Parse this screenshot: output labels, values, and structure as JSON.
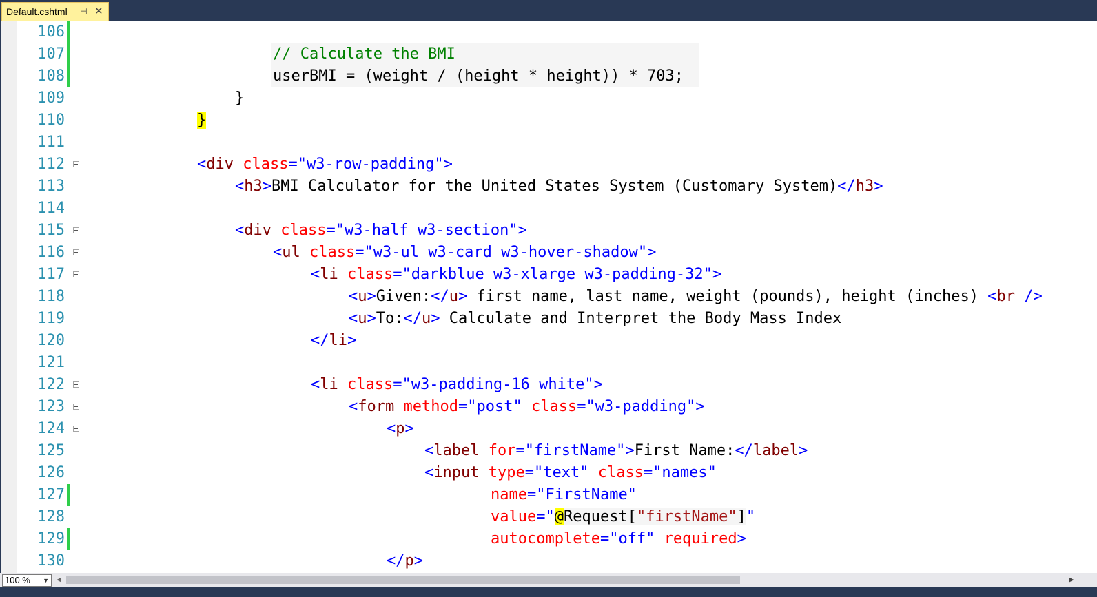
{
  "tab": {
    "label": "Default.cshtml",
    "pin_glyph": "⊣",
    "close_glyph": "✕"
  },
  "zoom": {
    "value": "100 %"
  },
  "lines": [
    {
      "num": "106",
      "changed": true,
      "fold": false
    },
    {
      "num": "107",
      "changed": true,
      "fold": false
    },
    {
      "num": "108",
      "changed": true,
      "fold": false
    },
    {
      "num": "109",
      "changed": false,
      "fold": false
    },
    {
      "num": "110",
      "changed": false,
      "fold": false
    },
    {
      "num": "111",
      "changed": false,
      "fold": false
    },
    {
      "num": "112",
      "changed": false,
      "fold": true
    },
    {
      "num": "113",
      "changed": false,
      "fold": false
    },
    {
      "num": "114",
      "changed": false,
      "fold": false
    },
    {
      "num": "115",
      "changed": false,
      "fold": true
    },
    {
      "num": "116",
      "changed": false,
      "fold": true
    },
    {
      "num": "117",
      "changed": false,
      "fold": true
    },
    {
      "num": "118",
      "changed": false,
      "fold": false
    },
    {
      "num": "119",
      "changed": false,
      "fold": false
    },
    {
      "num": "120",
      "changed": false,
      "fold": false
    },
    {
      "num": "121",
      "changed": false,
      "fold": false
    },
    {
      "num": "122",
      "changed": false,
      "fold": true
    },
    {
      "num": "123",
      "changed": false,
      "fold": true
    },
    {
      "num": "124",
      "changed": false,
      "fold": true
    },
    {
      "num": "125",
      "changed": false,
      "fold": false
    },
    {
      "num": "126",
      "changed": false,
      "fold": false
    },
    {
      "num": "127",
      "changed": true,
      "fold": false
    },
    {
      "num": "128",
      "changed": false,
      "fold": false
    },
    {
      "num": "129",
      "changed": true,
      "fold": false
    },
    {
      "num": "130",
      "changed": false,
      "fold": false
    }
  ],
  "code": {
    "l107": "// Calculate the BMI",
    "l108": "userBMI = (weight / (height * height)) * 703;",
    "l109": "}",
    "l110": "}",
    "l112": {
      "open": "<",
      "tag": "div",
      "attr": "class",
      "eq": "=",
      "val": "\"w3-row-padding\"",
      "close": ">"
    },
    "l113": {
      "open": "<",
      "tag": "h3",
      "close": ">",
      "text": "BMI Calculator for the United States System (Customary System)",
      "end_open": "</",
      "end_tag": "h3",
      "end_close": ">"
    },
    "l115": {
      "open": "<",
      "tag": "div",
      "attr": "class",
      "eq": "=",
      "val": "\"w3-half w3-section\"",
      "close": ">"
    },
    "l116": {
      "open": "<",
      "tag": "ul",
      "attr": "class",
      "eq": "=",
      "val": "\"w3-ul w3-card w3-hover-shadow\"",
      "close": ">"
    },
    "l117": {
      "open": "<",
      "tag": "li",
      "attr": "class",
      "eq": "=",
      "val": "\"darkblue w3-xlarge w3-padding-32\"",
      "close": ">"
    },
    "l118": {
      "open": "<",
      "tag": "u",
      "close": ">",
      "inner": "Given:",
      "end_open": "</",
      "end_tag": "u",
      "end_close": ">",
      "text": " first name, last name, weight (pounds), height (inches) ",
      "br_open": "<",
      "br_tag": "br",
      "br_close": " />"
    },
    "l119": {
      "open": "<",
      "tag": "u",
      "close": ">",
      "inner": "To:",
      "end_open": "</",
      "end_tag": "u",
      "end_close": ">",
      "text": " Calculate and Interpret the Body Mass Index"
    },
    "l120": {
      "open": "</",
      "tag": "li",
      "close": ">"
    },
    "l122": {
      "open": "<",
      "tag": "li",
      "attr": "class",
      "eq": "=",
      "val": "\"w3-padding-16 white\"",
      "close": ">"
    },
    "l123": {
      "open": "<",
      "tag": "form",
      "attr1": "method",
      "eq": "=",
      "val1": "\"post\"",
      "attr2": "class",
      "val2": "\"w3-padding\"",
      "close": ">"
    },
    "l124": {
      "open": "<",
      "tag": "p",
      "close": ">"
    },
    "l125": {
      "open": "<",
      "tag": "label",
      "attr": "for",
      "eq": "=",
      "val": "\"firstName\"",
      "close": ">",
      "text": "First Name:",
      "end_open": "</",
      "end_tag": "label",
      "end_close": ">"
    },
    "l126": {
      "open": "<",
      "tag": "input",
      "attr1": "type",
      "eq": "=",
      "val1": "\"text\"",
      "attr2": "class",
      "val2": "\"names\""
    },
    "l127": {
      "attr": "name",
      "eq": "=",
      "val": "\"FirstName\""
    },
    "l128": {
      "attr": "value",
      "eq": "=",
      "q1": "\"",
      "razor": "@",
      "expr1": "Request[",
      "str": "\"firstName\"",
      "expr2": "]",
      "q2": "\""
    },
    "l129": {
      "attr1": "autocomplete",
      "eq": "=",
      "val1": "\"off\"",
      "attr2": "required",
      "close": ">"
    },
    "l130": {
      "open": "</",
      "tag": "p",
      "close": ">"
    }
  }
}
